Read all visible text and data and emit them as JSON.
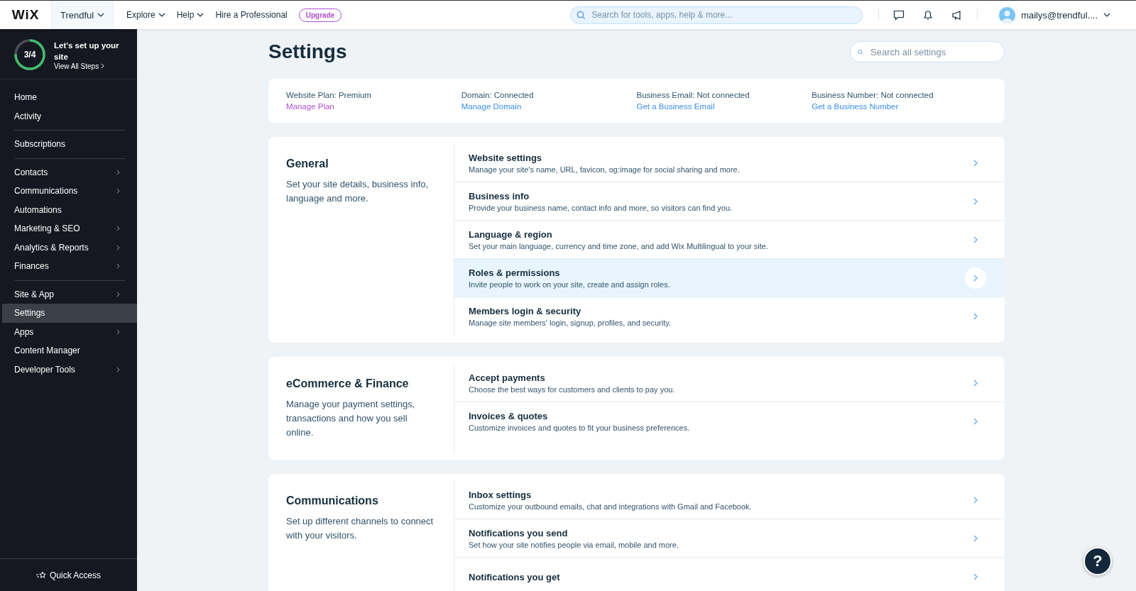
{
  "topbar": {
    "logo": "WiX",
    "site": "Trendful",
    "menus": [
      {
        "label": "Explore",
        "dropdown": true
      },
      {
        "label": "Help",
        "dropdown": true
      },
      {
        "label": "Hire a Professional",
        "dropdown": false
      }
    ],
    "upgrade": "Upgrade",
    "search": {
      "placeholder": "Search for tools, apps, help & more..."
    },
    "account": "mailys@trendful...."
  },
  "setup": {
    "progress": "3/4",
    "level": 0.75,
    "title": "Let's set up your site",
    "link": "View All Steps"
  },
  "sidebar": {
    "groups": [
      [
        {
          "label": "Home",
          "expandable": false,
          "selected": false
        },
        {
          "label": "Activity",
          "expandable": false,
          "selected": false
        }
      ],
      [
        {
          "label": "Subscriptions",
          "expandable": false,
          "selected": false
        }
      ],
      [
        {
          "label": "Contacts",
          "expandable": true,
          "selected": false
        },
        {
          "label": "Communications",
          "expandable": true,
          "selected": false
        },
        {
          "label": "Automations",
          "expandable": false,
          "selected": false
        },
        {
          "label": "Marketing & SEO",
          "expandable": true,
          "selected": false
        },
        {
          "label": "Analytics & Reports",
          "expandable": true,
          "selected": false
        },
        {
          "label": "Finances",
          "expandable": true,
          "selected": false
        }
      ],
      [
        {
          "label": "Site & App",
          "expandable": true,
          "selected": false
        },
        {
          "label": "Settings",
          "expandable": false,
          "selected": true
        },
        {
          "label": "Apps",
          "expandable": true,
          "selected": false
        },
        {
          "label": "Content Manager",
          "expandable": false,
          "selected": false
        },
        {
          "label": "Developer Tools",
          "expandable": true,
          "selected": false
        }
      ]
    ],
    "quick_access": "Quick Access"
  },
  "page": {
    "title": "Settings",
    "search": {
      "placeholder": "Search all settings"
    }
  },
  "summary": [
    {
      "label": "Website Plan: Premium",
      "link": "Manage Plan",
      "color": "#b04fd0"
    },
    {
      "label": "Domain: Connected",
      "link": "Manage Domain",
      "color": "#3b8fe8"
    },
    {
      "label": "Business Email: Not connected",
      "link": "Get a Business Email",
      "color": "#3b8fe8"
    },
    {
      "label": "Business Number: Not connected",
      "link": "Get a Business Number",
      "color": "#3b8fe8"
    }
  ],
  "sections": [
    {
      "title": "General",
      "description": "Set your site details, business info, language and more.",
      "rows": [
        {
          "title": "Website settings",
          "description": "Manage your site's name, URL, favicon, og:image for social sharing and more.",
          "highlighted": false
        },
        {
          "title": "Business info",
          "description": "Provide your business name, contact info and more, so visitors can find you.",
          "highlighted": false
        },
        {
          "title": "Language & region",
          "description": "Set your main language, currency and time zone, and add Wix Multilingual to your site.",
          "highlighted": false
        },
        {
          "title": "Roles & permissions",
          "description": "Invite people to work on your site, create and assign roles.",
          "highlighted": true
        },
        {
          "title": "Members login & security",
          "description": "Manage site members' login, signup, profiles, and security.",
          "highlighted": false
        }
      ]
    },
    {
      "title": "eCommerce & Finance",
      "description": "Manage your payment settings, transactions and how you sell online.",
      "rows": [
        {
          "title": "Accept payments",
          "description": "Choose the best ways for customers and clients to pay you.",
          "highlighted": false
        },
        {
          "title": "Invoices & quotes",
          "description": "Customize invoices and quotes to fit your business preferences.",
          "highlighted": false
        }
      ]
    },
    {
      "title": "Communications",
      "description": "Set up different channels to connect with your visitors.",
      "rows": [
        {
          "title": "Inbox settings",
          "description": "Customize your outbound emails, chat and integrations with Gmail and Facebook.",
          "highlighted": false
        },
        {
          "title": "Notifications you send",
          "description": "Set how your site notifies people via email, mobile and more.",
          "highlighted": false
        },
        {
          "title": "Notifications you get",
          "highlighted": false
        }
      ]
    }
  ],
  "help": "?"
}
